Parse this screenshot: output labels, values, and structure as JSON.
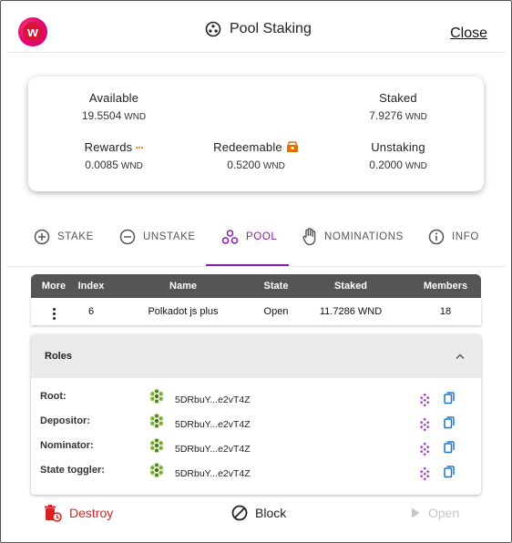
{
  "header": {
    "logo_letter": "w",
    "title": "Pool Staking",
    "close_label": "Close"
  },
  "balances": {
    "unit": "WND",
    "available": {
      "label": "Available",
      "value": "19.5504"
    },
    "staked": {
      "label": "Staked",
      "value": "7.9276"
    },
    "rewards": {
      "label": "Rewards",
      "value": "0.0085",
      "indicator": "···"
    },
    "redeemable": {
      "label": "Redeemable",
      "value": "0.5200"
    },
    "unstaking": {
      "label": "Unstaking",
      "value": "0.2000"
    }
  },
  "tabs": [
    {
      "label": "STAKE",
      "icon": "plus-circle-icon",
      "active": false
    },
    {
      "label": "UNSTAKE",
      "icon": "minus-circle-icon",
      "active": false
    },
    {
      "label": "POOL",
      "icon": "pool-icon",
      "active": true
    },
    {
      "label": "NOMINATIONS",
      "icon": "hand-icon",
      "active": false
    },
    {
      "label": "INFO",
      "icon": "info-icon",
      "active": false
    }
  ],
  "pool_table": {
    "columns": [
      "More",
      "Index",
      "Name",
      "State",
      "Staked",
      "Members"
    ],
    "row": {
      "index": "6",
      "name": "Polkadot js plus",
      "state": "Open",
      "staked": "11.7286 WND",
      "members": "18"
    }
  },
  "roles": {
    "title": "Roles",
    "items": [
      {
        "label": "Root:",
        "address": "5DRbuY...e2vT4Z"
      },
      {
        "label": "Depositor:",
        "address": "5DRbuY...e2vT4Z"
      },
      {
        "label": "Nominator:",
        "address": "5DRbuY...e2vT4Z"
      },
      {
        "label": "State toggler:",
        "address": "5DRbuY...e2vT4Z"
      }
    ]
  },
  "actions": {
    "destroy_label": "Destroy",
    "block_label": "Block",
    "open_label": "Open"
  },
  "colors": {
    "accent": "#8a1bb0",
    "destroy": "#dd1f1f",
    "reward_dots": "#e66c00",
    "table_header": "#555555",
    "disabled": "#c6c6c6"
  }
}
